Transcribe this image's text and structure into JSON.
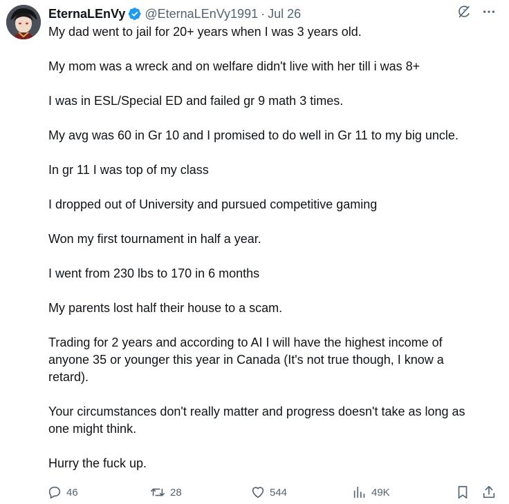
{
  "author": {
    "display_name": "EternaLEnVy",
    "handle": "@EternaLEnVy1991",
    "date": "Jul 26",
    "verified": true,
    "verified_color": "#1d9bf0"
  },
  "header_icons": [
    "grok-icon",
    "more-icon"
  ],
  "body": {
    "paragraphs": [
      "My dad went to jail for 20+ years when I was 3 years old.",
      "My mom was a wreck and on welfare didn't live with her till i was 8+",
      "I was in ESL/Special ED and failed gr 9 math 3 times.",
      "My avg was 60 in Gr 10 and I promised to do well in Gr 11 to my big uncle.",
      "In gr 11 I was top of my class",
      "I dropped out of University and pursued competitive gaming",
      "Won my first tournament in half a year.",
      "I went from 230 lbs to 170 in 6 months",
      "My parents lost half their house to a scam.",
      "Trading for 2 years and according to AI I will have the highest income of\nanyone 35 or younger this year in Canada (It's not true though, I know a\nretard).",
      "Your circumstances don't really matter and progress doesn't take as long as\none might think.",
      "Hurry the fuck up."
    ]
  },
  "actions": {
    "replies": "46",
    "retweets": "28",
    "likes": "544",
    "views": "49K"
  },
  "colors": {
    "text": "#0f1419",
    "secondary": "#536471",
    "accent": "#1d9bf0"
  }
}
